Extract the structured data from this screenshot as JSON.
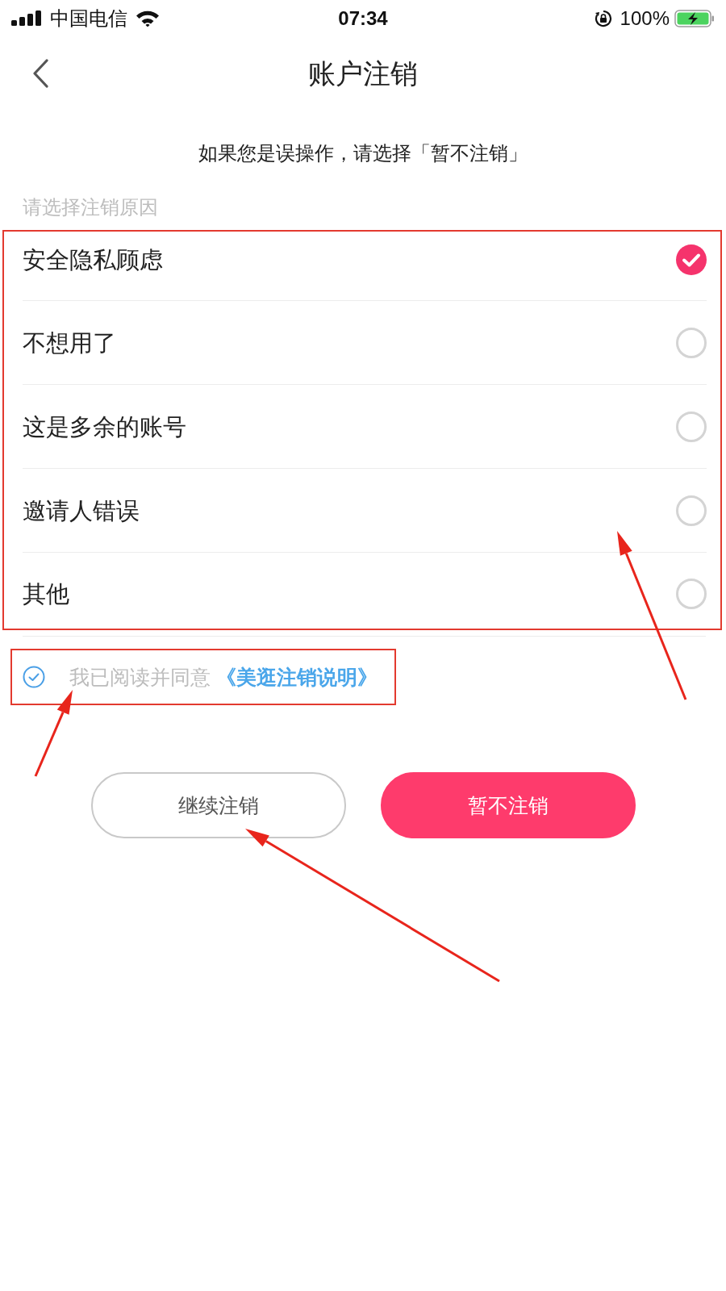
{
  "status_bar": {
    "carrier": "中国电信",
    "time": "07:34",
    "battery": "100%"
  },
  "nav": {
    "title": "账户注销"
  },
  "notice": "如果您是误操作，请选择「暂不注销」",
  "reasons": {
    "heading": "请选择注销原因",
    "options": [
      {
        "label": "安全隐私顾虑",
        "selected": true
      },
      {
        "label": "不想用了",
        "selected": false
      },
      {
        "label": "这是多余的账号",
        "selected": false
      },
      {
        "label": "邀请人错误",
        "selected": false
      },
      {
        "label": "其他",
        "selected": false
      }
    ]
  },
  "agreement": {
    "checked": true,
    "text": "我已阅读并同意",
    "link": "《美逛注销说明》"
  },
  "buttons": [
    {
      "label": "继续注销",
      "kind": "secondary"
    },
    {
      "label": "暂不注销",
      "kind": "primary"
    }
  ]
}
